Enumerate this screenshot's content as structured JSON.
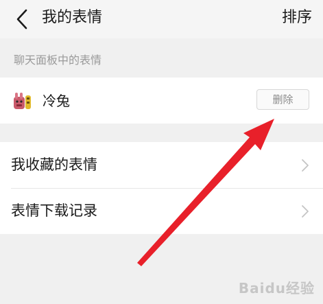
{
  "header": {
    "title": "我的表情",
    "sort_label": "排序",
    "back_icon": "chevron-left-icon"
  },
  "chat_panel": {
    "section_label": "聊天面板中的表情",
    "emoji_pack": {
      "name": "冷兔",
      "delete_label": "删除"
    }
  },
  "menu": {
    "items": [
      {
        "label": "我收藏的表情",
        "icon": "chevron-right-icon"
      },
      {
        "label": "表情下载记录",
        "icon": "chevron-right-icon"
      }
    ]
  },
  "annotation": {
    "arrow_color": "#e8202a"
  },
  "watermark": {
    "text": "Baidu经验"
  },
  "colors": {
    "background": "#f0f0f0",
    "card": "#ffffff",
    "secondary_text": "#9a9a9a"
  }
}
